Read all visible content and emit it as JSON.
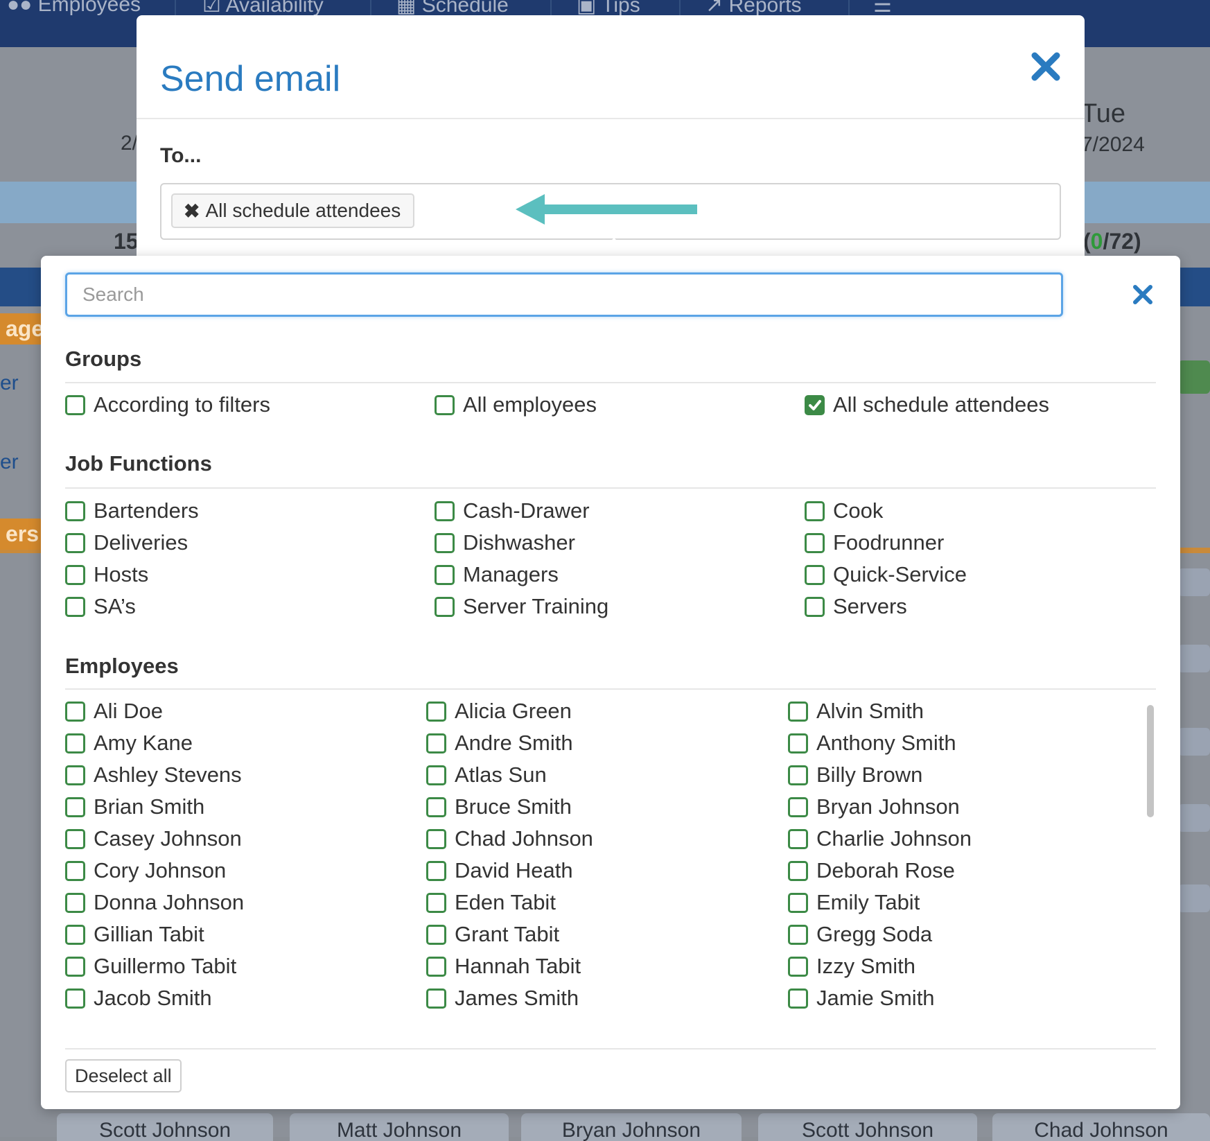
{
  "background": {
    "nav": [
      {
        "label": "Employees"
      },
      {
        "label": "Availability"
      },
      {
        "label": "Schedule"
      },
      {
        "label": "Tips"
      },
      {
        "label": "Reports"
      }
    ],
    "day_name": "Tue",
    "left_date_fragment": "2/",
    "right_date_fragment": "7/2024",
    "left_count_fragment": "15",
    "right_count_fragment": "(0/72)",
    "right_count_highlight": "0",
    "orange_labels": [
      "ager",
      "ers"
    ],
    "side_labels": [
      "er",
      "er"
    ],
    "bottom_names": [
      "Scott Johnson",
      "Matt Johnson",
      "Bryan Johnson",
      "Scott Johnson",
      "Chad Johnson"
    ]
  },
  "modal": {
    "title": "Send email",
    "to_label": "To...",
    "selected_chip": "All schedule attendees"
  },
  "dropdown": {
    "search_placeholder": "Search",
    "sections": {
      "groups": {
        "title": "Groups",
        "items": [
          {
            "label": "According to filters",
            "checked": false
          },
          {
            "label": "All employees",
            "checked": false
          },
          {
            "label": "All schedule attendees",
            "checked": true
          }
        ]
      },
      "job_functions": {
        "title": "Job Functions",
        "items": [
          {
            "label": "Bartenders",
            "checked": false
          },
          {
            "label": "Cash-Drawer",
            "checked": false
          },
          {
            "label": "Cook",
            "checked": false
          },
          {
            "label": "Deliveries",
            "checked": false
          },
          {
            "label": "Dishwasher",
            "checked": false
          },
          {
            "label": "Foodrunner",
            "checked": false
          },
          {
            "label": "Hosts",
            "checked": false
          },
          {
            "label": "Managers",
            "checked": false
          },
          {
            "label": "Quick-Service",
            "checked": false
          },
          {
            "label": "SA’s",
            "checked": false
          },
          {
            "label": "Server Training",
            "checked": false
          },
          {
            "label": "Servers",
            "checked": false
          }
        ]
      },
      "employees": {
        "title": "Employees",
        "items": [
          {
            "label": "Ali Doe",
            "checked": false
          },
          {
            "label": "Alicia Green",
            "checked": false
          },
          {
            "label": "Alvin Smith",
            "checked": false
          },
          {
            "label": "Amy Kane",
            "checked": false
          },
          {
            "label": "Andre Smith",
            "checked": false
          },
          {
            "label": "Anthony Smith",
            "checked": false
          },
          {
            "label": "Ashley Stevens",
            "checked": false
          },
          {
            "label": "Atlas Sun",
            "checked": false
          },
          {
            "label": "Billy Brown",
            "checked": false
          },
          {
            "label": "Brian Smith",
            "checked": false
          },
          {
            "label": "Bruce Smith",
            "checked": false
          },
          {
            "label": "Bryan Johnson",
            "checked": false
          },
          {
            "label": "Casey Johnson",
            "checked": false
          },
          {
            "label": "Chad Johnson",
            "checked": false
          },
          {
            "label": "Charlie Johnson",
            "checked": false
          },
          {
            "label": "Cory Johnson",
            "checked": false
          },
          {
            "label": "David Heath",
            "checked": false
          },
          {
            "label": "Deborah Rose",
            "checked": false
          },
          {
            "label": "Donna Johnson",
            "checked": false
          },
          {
            "label": "Eden Tabit",
            "checked": false
          },
          {
            "label": "Emily Tabit",
            "checked": false
          },
          {
            "label": "Gillian Tabit",
            "checked": false
          },
          {
            "label": "Grant Tabit",
            "checked": false
          },
          {
            "label": "Gregg Soda",
            "checked": false
          },
          {
            "label": "Guillermo Tabit",
            "checked": false
          },
          {
            "label": "Hannah Tabit",
            "checked": false
          },
          {
            "label": "Izzy Smith",
            "checked": false
          },
          {
            "label": "Jacob Smith",
            "checked": false
          },
          {
            "label": "James Smith",
            "checked": false
          },
          {
            "label": "Jamie Smith",
            "checked": false
          }
        ]
      }
    },
    "deselect_all_label": "Deselect all"
  },
  "colors": {
    "title_blue": "#2a7bc0",
    "checkbox_green": "#3c8a46",
    "arrow_teal": "#5bbfbf",
    "nav_bg": "#1f3a6e"
  }
}
